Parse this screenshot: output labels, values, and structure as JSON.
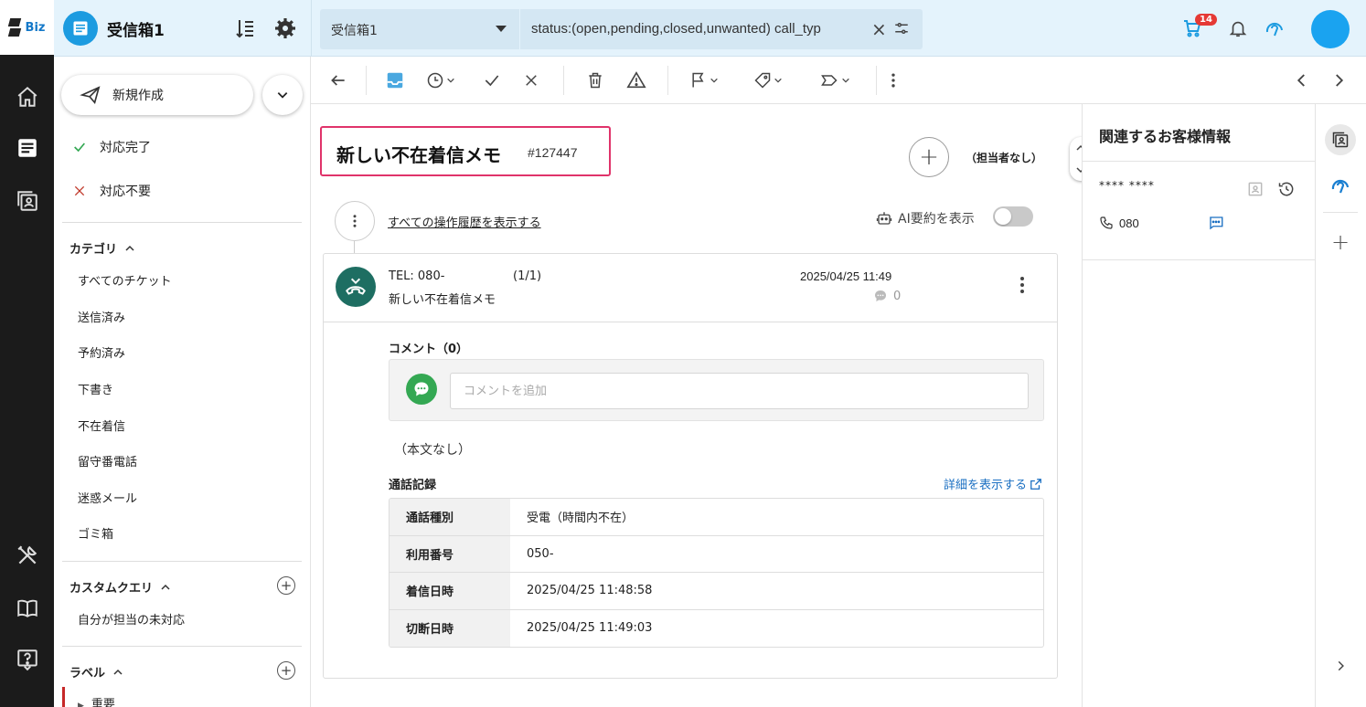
{
  "app": {
    "logo_text": "Biz"
  },
  "header": {
    "inbox_title": "受信箱1",
    "inbox_select": "受信箱1",
    "query": "status:(open,pending,closed,unwanted) call_typ",
    "cart_badge": "14"
  },
  "sidebar": {
    "new_button": "新規作成",
    "quick": [
      {
        "label": "対応完了",
        "icon": "check-icon"
      },
      {
        "label": "対応不要",
        "icon": "close-icon"
      }
    ],
    "category_header": "カテゴリ",
    "categories": [
      "すべてのチケット",
      "送信済み",
      "予約済み",
      "下書き",
      "不在着信",
      "留守番電話",
      "迷惑メール",
      "ゴミ箱"
    ],
    "custom_query_header": "カスタムクエリ",
    "custom_queries": [
      "自分が担当の未対応"
    ],
    "label_header": "ラベル",
    "labels": [
      "重要"
    ]
  },
  "ticket": {
    "title": "新しい不在着信メモ",
    "number": "#127447",
    "assignee": "（担当者なし）",
    "history_link": "すべての操作履歴を表示する",
    "ai_summary_label": "AI要約を表示",
    "ai_summary_enabled": false
  },
  "message": {
    "from": "TEL: 080-",
    "count": "(1/1)",
    "subject": "新しい不在着信メモ",
    "date": "2025/04/25 11:49",
    "comment_count": "0",
    "comments_title": "コメント（0）",
    "comment_placeholder": "コメントを追加",
    "body": "（本文なし）",
    "call_log_title": "通話記録",
    "call_log_link": "詳細を表示する",
    "call_log": [
      {
        "key": "通話種別",
        "value": "受電（時間内不在）"
      },
      {
        "key": "利用番号",
        "value": "050-"
      },
      {
        "key": "着信日時",
        "value": "2025/04/25 11:48:58"
      },
      {
        "key": "切断日時",
        "value": "2025/04/25 11:49:03"
      }
    ]
  },
  "customer_panel": {
    "title": "関連するお客様情報",
    "name": "**** ****",
    "phone": "080"
  },
  "colors": {
    "accent": "#1c9be0",
    "title_highlight": "#e0336a",
    "call_avatar": "#1e6e62",
    "comment_icon": "#34a853",
    "badge": "#e53935"
  }
}
